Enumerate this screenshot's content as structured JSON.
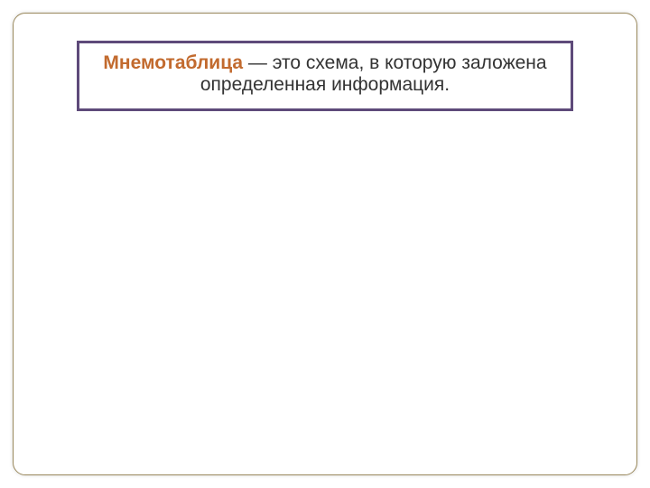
{
  "definition": {
    "term": "Мнемотаблица",
    "text_part1": " — это схема, в которую заложена",
    "text_part2": "определенная информация."
  }
}
